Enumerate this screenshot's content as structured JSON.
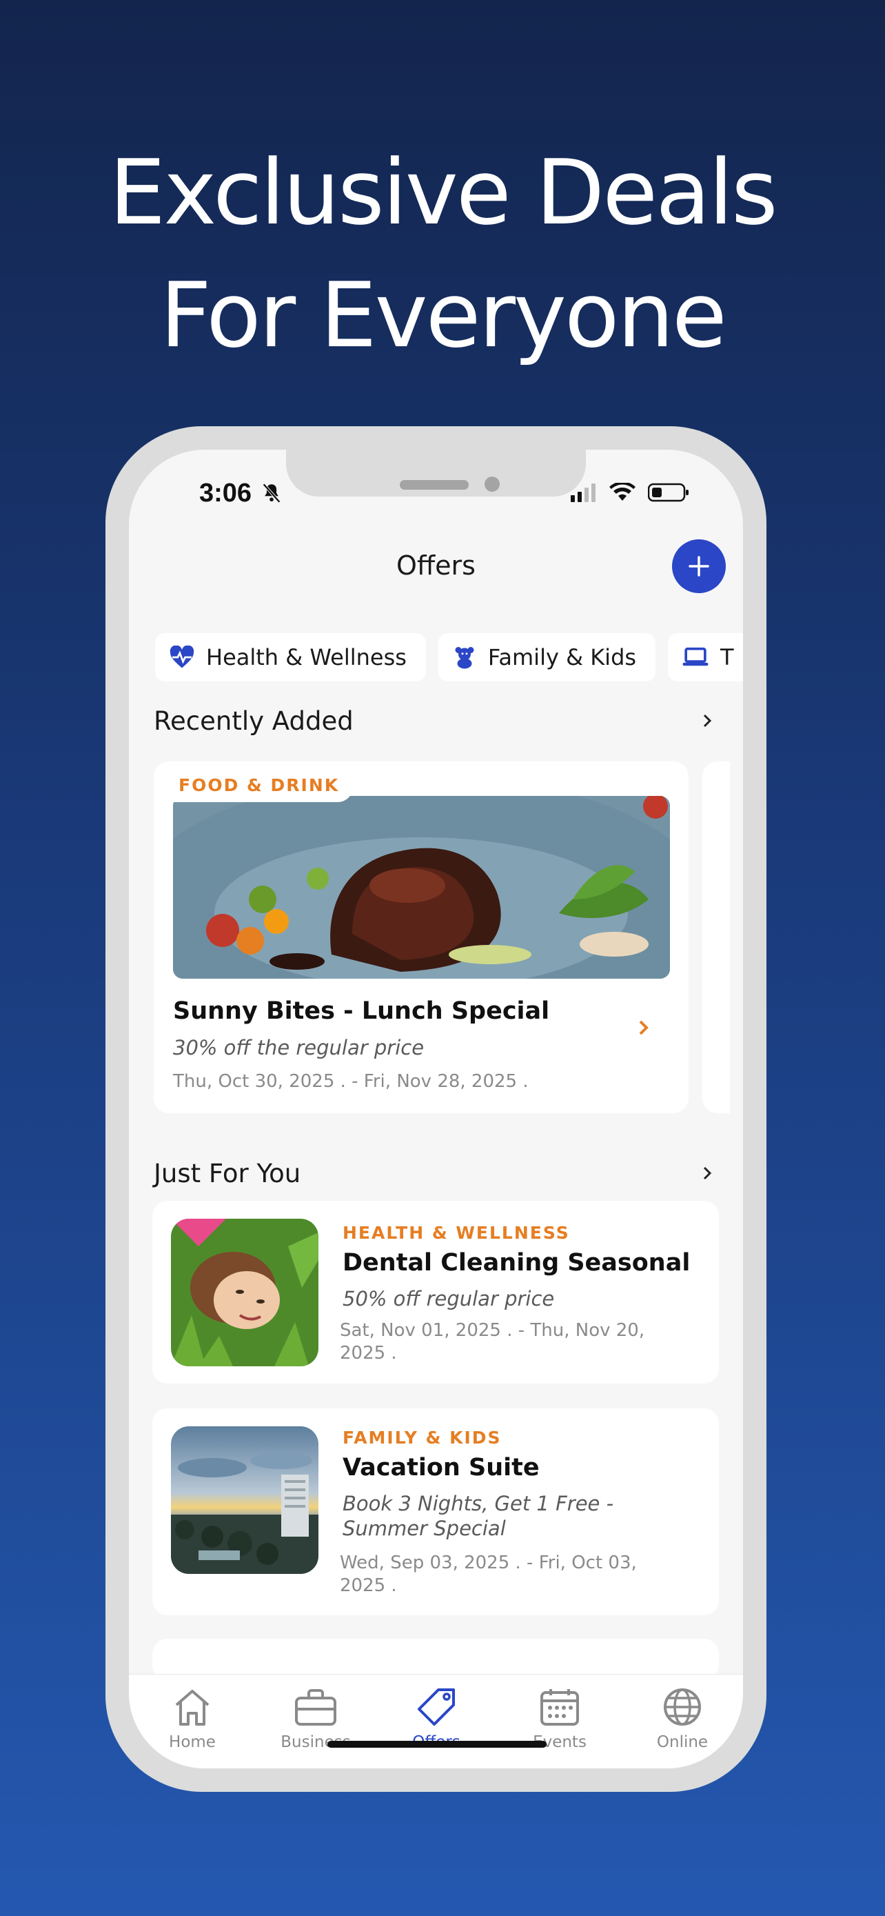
{
  "headline": {
    "line1": "Exclusive Deals",
    "line2": "For Everyone"
  },
  "status_bar": {
    "time": "3:06"
  },
  "nav": {
    "title": "Offers",
    "add_label": "+"
  },
  "chips": [
    {
      "label": "Health & Wellness",
      "icon": "heart-pulse-icon"
    },
    {
      "label": "Family & Kids",
      "icon": "teddy-bear-icon"
    },
    {
      "label": "T",
      "icon": "laptop-icon"
    }
  ],
  "recently_added": {
    "title": "Recently Added",
    "card": {
      "category": "FOOD & DRINK",
      "title": "Sunny Bites - Lunch Special",
      "subtitle": "30% off the regular price",
      "dates": "Thu, Oct 30, 2025 .  - Fri, Nov 28, 2025 ."
    }
  },
  "just_for_you": {
    "title": "Just For You",
    "items": [
      {
        "category": "HEALTH & WELLNESS",
        "title": "Dental Cleaning Seasonal",
        "subtitle": "50% off regular price",
        "dates_line1": "Sat, Nov 01, 2025 .  - Thu, Nov 20,",
        "dates_line2": "2025 ."
      },
      {
        "category": "FAMILY & KIDS",
        "title": "Vacation Suite",
        "subtitle_line1": "Book 3 Nights, Get 1 Free -",
        "subtitle_line2": "Summer Special",
        "dates_line1": "Wed, Sep 03, 2025 .  - Fri, Oct 03,",
        "dates_line2": "2025 ."
      }
    ]
  },
  "tabs": [
    {
      "label": "Home",
      "icon": "home-icon"
    },
    {
      "label": "Business",
      "icon": "briefcase-icon"
    },
    {
      "label": "Offers",
      "icon": "tag-icon",
      "active": true
    },
    {
      "label": "Events",
      "icon": "calendar-icon"
    },
    {
      "label": "Online",
      "icon": "globe-icon"
    }
  ],
  "colors": {
    "accent": "#2b46c6",
    "category": "#e67e22",
    "background_top": "#13254d",
    "background_bottom": "#2458b0"
  }
}
